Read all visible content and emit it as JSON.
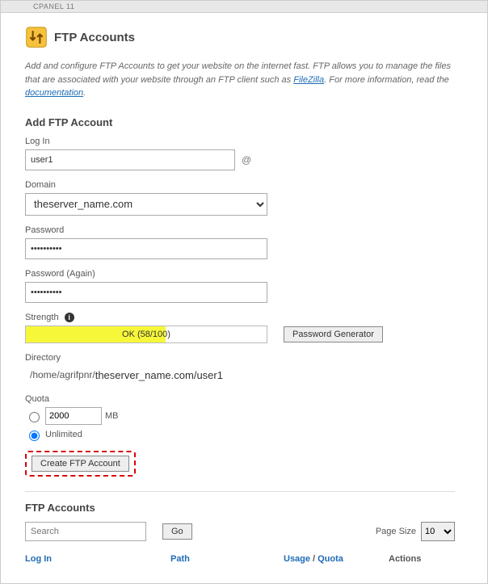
{
  "topbar": {
    "brand": "CPANEL 11"
  },
  "header": {
    "title": "FTP Accounts"
  },
  "intro": {
    "text_a": "Add and configure FTP Accounts to get your website on the internet fast. FTP allows you to manage the files that are associated with your website through an FTP client such as ",
    "link1": "FileZilla",
    "text_b": ". For more information, read the ",
    "link2": "documentation",
    "text_c": "."
  },
  "form": {
    "heading": "Add FTP Account",
    "login_label": "Log In",
    "login_value": "user1",
    "at": "@",
    "domain_label": "Domain",
    "domain_value": "theserver_name.com",
    "password_label": "Password",
    "password_value": "••••••••••",
    "password2_label": "Password (Again)",
    "password2_value": "••••••••••",
    "strength_label": "Strength",
    "strength_text": "OK (58/100)",
    "strength_pct": "58",
    "pwgen_label": "Password Generator",
    "directory_label": "Directory",
    "directory_prefix": "/home/agrifpnr/",
    "directory_value": "theserver_name.com/user1",
    "quota_label": "Quota",
    "quota_mb_value": "2000",
    "quota_mb_unit": "MB",
    "quota_unlimited": "Unlimited",
    "create_label": "Create FTP Account"
  },
  "list": {
    "heading": "FTP Accounts",
    "search_placeholder": "Search",
    "search_value": "",
    "go_label": "Go",
    "pagesize_label": "Page Size",
    "pagesize_value": "10",
    "columns": {
      "login": "Log In",
      "path": "Path",
      "usage": "Usage",
      "quota": "Quota",
      "actions": "Actions"
    }
  }
}
